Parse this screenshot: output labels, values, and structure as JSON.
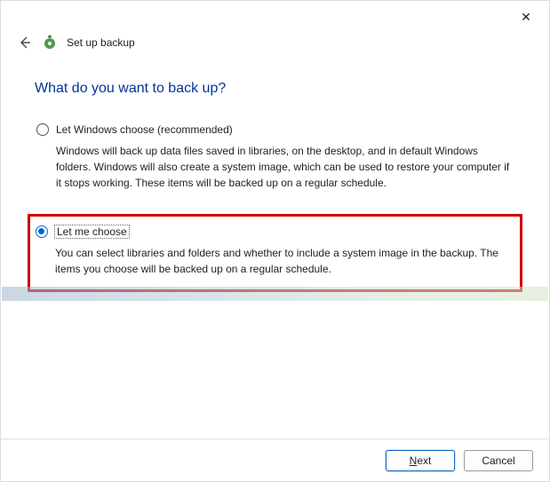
{
  "titlebar": {
    "close": "✕"
  },
  "header": {
    "title": "Set up backup"
  },
  "heading": "What do you want to back up?",
  "options": {
    "auto": {
      "label": "Let Windows choose (recommended)",
      "desc": "Windows will back up data files saved in libraries, on the desktop, and in default Windows folders. Windows will also create a system image, which can be used to restore your computer if it stops working. These items will be backed up on a regular schedule."
    },
    "manual": {
      "label": "Let me choose",
      "desc": "You can select libraries and folders and whether to include a system image in the backup. The items you choose will be backed up on a regular schedule."
    }
  },
  "footer": {
    "next_prefix": "N",
    "next_rest": "ext",
    "cancel": "Cancel"
  }
}
